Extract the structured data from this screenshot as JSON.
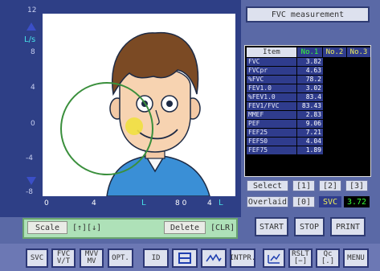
{
  "graph": {
    "y_max_label": "12",
    "y_unit": "L/s",
    "y_ticks": [
      "8",
      "4",
      "0",
      "-4",
      "-8"
    ],
    "x_ticks": [
      "0",
      "4",
      "8 0",
      "4"
    ],
    "x_unit_left": "L",
    "x_unit_right": "L"
  },
  "scale": {
    "scale_label": "Scale",
    "scale_keys": "[↑][↓]",
    "delete_label": "Delete",
    "delete_key": "[CLR]"
  },
  "panel": {
    "title": "FVC measurement",
    "table": {
      "headers": [
        "Item",
        "No.1",
        "No.2",
        "No.3"
      ],
      "rows": [
        {
          "name": "FVC",
          "value": "3.82"
        },
        {
          "name": "FVCpr",
          "value": "4.63"
        },
        {
          "name": "%FVC",
          "value": "78.2"
        },
        {
          "name": "FEV1.0",
          "value": "3.02"
        },
        {
          "name": "%FEV1.0",
          "value": "83.4"
        },
        {
          "name": "FEV1/FVC",
          "value": "83.43"
        },
        {
          "name": "MMEF",
          "value": "2.83"
        },
        {
          "name": "PEF",
          "value": "9.06"
        },
        {
          "name": "FEF25",
          "value": "7.21"
        },
        {
          "name": "FEF50",
          "value": "4.04"
        },
        {
          "name": "FEF75",
          "value": "1.89"
        }
      ]
    },
    "select_label": "Select",
    "select_options": [
      "[1]",
      "[2]",
      "[3]"
    ],
    "overlaid_label": "Overlaid",
    "overlaid_option": "[0]",
    "svc_label": "SVC",
    "svc_value": "3.72",
    "start_label": "START",
    "stop_label": "STOP",
    "print_label": "PRINT"
  },
  "toolbar": {
    "svc": "SVC",
    "fvc_vt": [
      "FVC",
      "V/T"
    ],
    "mvv": [
      "MVV",
      "MV"
    ],
    "opt": "OPT.",
    "id": "ID",
    "intpr": "INTPR.",
    "rslt": [
      "RSLT",
      "[−]"
    ],
    "qc": [
      "Qc",
      "[.]"
    ],
    "menu": "MENU"
  },
  "colors": {
    "panel_blue": "#2e3f86",
    "loop_green": "#3a8f3c",
    "highlight_yellow": "#f0e040",
    "value_green": "#37ff37",
    "header_yellow": "#f0f05a",
    "cyan_text": "#46e0e8"
  }
}
